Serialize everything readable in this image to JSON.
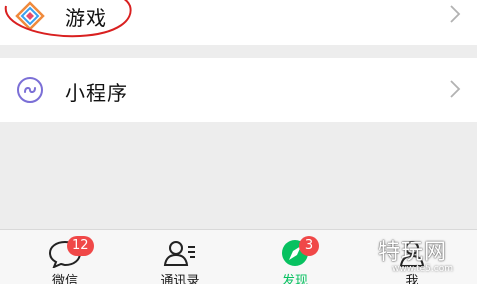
{
  "list": {
    "games_label": "游戏",
    "mini_programs_label": "小程序"
  },
  "tabbar": {
    "tabs": [
      {
        "label": "微信",
        "badge": "12"
      },
      {
        "label": "通讯录",
        "badge": ""
      },
      {
        "label": "发现",
        "badge": "3"
      },
      {
        "label": "我",
        "badge": ""
      }
    ]
  },
  "watermark": {
    "title": "特玩网",
    "url": "www.te5.com"
  },
  "colors": {
    "background": "#ededed",
    "active_tab": "#07c160",
    "badge": "#f04848",
    "highlight_ring": "#d92020"
  }
}
